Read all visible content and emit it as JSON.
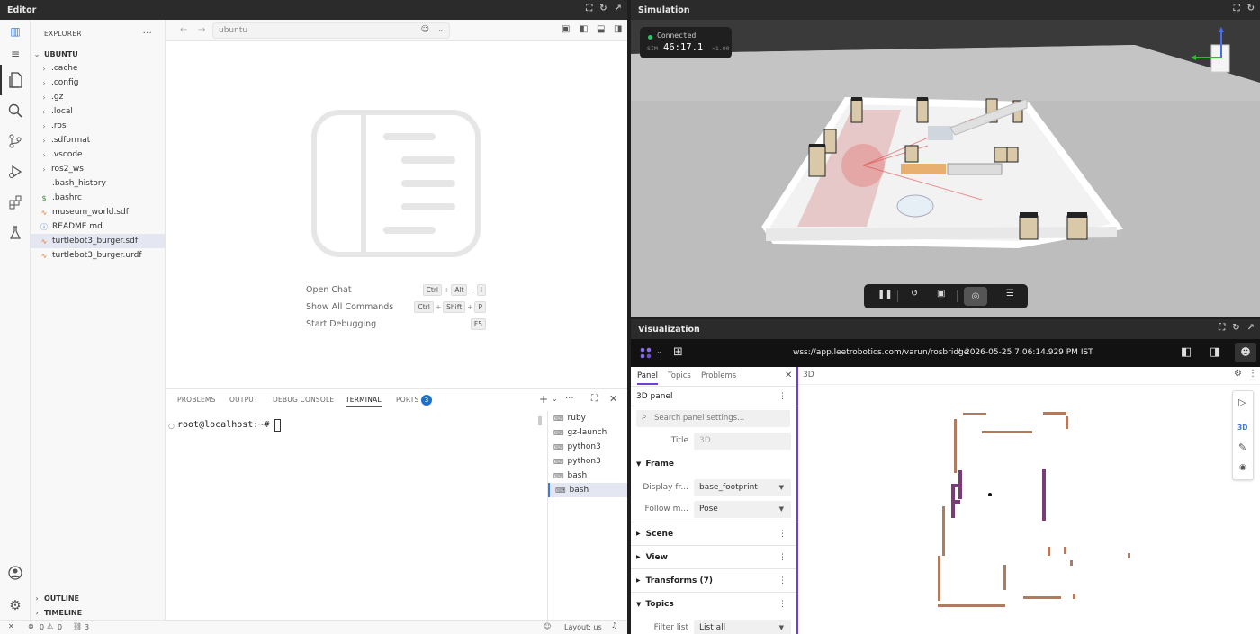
{
  "editor": {
    "title": "Editor",
    "search_text": "ubuntu",
    "explorer_label": "EXPLORER",
    "root_label": "UBUNTU",
    "tree": [
      {
        "name": ".cache",
        "kind": "folder"
      },
      {
        "name": ".config",
        "kind": "folder"
      },
      {
        "name": ".gz",
        "kind": "folder"
      },
      {
        "name": ".local",
        "kind": "folder"
      },
      {
        "name": ".ros",
        "kind": "folder"
      },
      {
        "name": ".sdformat",
        "kind": "folder"
      },
      {
        "name": ".vscode",
        "kind": "folder"
      },
      {
        "name": "ros2_ws",
        "kind": "folder"
      },
      {
        "name": ".bash_history",
        "kind": "file"
      },
      {
        "name": ".bashrc",
        "kind": "dollar"
      },
      {
        "name": "museum_world.sdf",
        "kind": "xml"
      },
      {
        "name": "README.md",
        "kind": "info"
      },
      {
        "name": "turtlebot3_burger.sdf",
        "kind": "xml",
        "selected": true
      },
      {
        "name": "turtlebot3_burger.urdf",
        "kind": "xml"
      }
    ],
    "outline_label": "OUTLINE",
    "timeline_label": "TIMELINE",
    "commands": [
      {
        "label": "Open Chat",
        "keys": [
          "Ctrl",
          "Alt",
          "I"
        ]
      },
      {
        "label": "Show All Commands",
        "keys": [
          "Ctrl",
          "Shift",
          "P"
        ]
      },
      {
        "label": "Start Debugging",
        "keys": [
          "F5"
        ]
      }
    ],
    "panel_tabs": [
      "PROBLEMS",
      "OUTPUT",
      "DEBUG CONSOLE",
      "TERMINAL",
      "PORTS"
    ],
    "ports_badge": "3",
    "terminal_prompt": "root@localhost:~#",
    "terminals": [
      "ruby",
      "gz-launch",
      "python3",
      "python3",
      "bash",
      "bash"
    ],
    "status": {
      "errors": "0",
      "warnings": "0",
      "ports": "3",
      "layout": "Layout: us"
    }
  },
  "simulation": {
    "title": "Simulation",
    "connection": "Connected",
    "sim_label": "SIM",
    "sim_time": "46:17.1",
    "rate": "×1.00"
  },
  "visualization": {
    "title": "Visualization",
    "url": "wss://app.leetrobotics.com/varun/rosbridge",
    "datetime": "2026-05-25 7:06:14.929 PM IST",
    "tabs": [
      "Panel",
      "Topics",
      "Problems"
    ],
    "panel_name": "3D panel",
    "search_placeholder": "Search panel settings...",
    "title_label": "Title",
    "title_value": "3D",
    "frame_label": "Frame",
    "display_frame_label": "Display fr...",
    "display_frame_value": "base_footprint",
    "follow_label": "Follow m...",
    "follow_value": "Pose",
    "sections": [
      "Scene",
      "View",
      "Transforms (7)"
    ],
    "topics_label": "Topics",
    "filter_label": "Filter list",
    "filter_value": "List all",
    "view_title": "3D",
    "view_tool_label": "3D",
    "accent": "#6f3fd6"
  }
}
